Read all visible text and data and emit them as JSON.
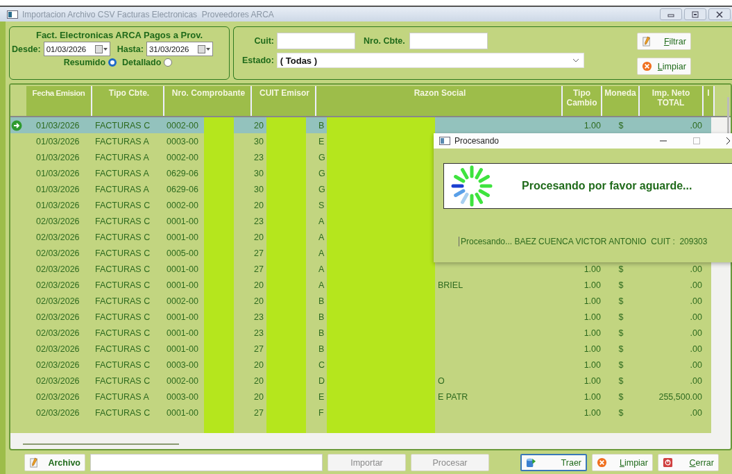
{
  "window": {
    "title": "Importacion Archivo CSV Facturas Electronicas  Proveedores ARCA"
  },
  "period_panel": {
    "title": "Fact. Electronicas ARCA Pagos a Prov.",
    "from_label": "Desde:",
    "from_value": "01/03/2026",
    "to_label": "Hasta:",
    "to_value": "31/03/2026",
    "options": [
      {
        "label": "Resumido",
        "selected": true
      },
      {
        "label": "Detallado",
        "selected": false
      }
    ]
  },
  "filter_panel": {
    "cuit_label": "Cuit:",
    "number_label": "Nro. Cbte.",
    "status_label": "Estado:",
    "status_value": "( Todas )",
    "buttons": [
      {
        "label": "Filtrar",
        "mnemonic": true
      },
      {
        "label": "Limpiar",
        "mnemonic": true
      }
    ]
  },
  "table": {
    "columns": [
      "Fecha Emision",
      "Tipo Cbte.",
      "Nro. Comprobante",
      "CUIT Emisor",
      "Razon Social",
      "Tipo Cambio",
      "Moneda",
      "Imp. Neto TOTAL",
      "I"
    ],
    "rows": [
      {
        "date": "01/03/2026",
        "type": "FACTURAS C",
        "number": "0002-00",
        "cuit": "20",
        "name": "B",
        "rate": "1.00",
        "currency": "$",
        "amount": ".00",
        "selected": true
      },
      {
        "date": "01/03/2026",
        "type": "FACTURAS A",
        "number": "0003-00",
        "cuit": "30",
        "name": "E",
        "selected": false
      },
      {
        "date": "01/03/2026",
        "type": "FACTURAS A",
        "number": "0002-00",
        "cuit": "23",
        "name": "G",
        "selected": false
      },
      {
        "date": "01/03/2026",
        "type": "FACTURAS A",
        "number": "0629-06",
        "cuit": "30",
        "name": "G",
        "selected": false
      },
      {
        "date": "01/03/2026",
        "type": "FACTURAS A",
        "number": "0629-06",
        "cuit": "30",
        "name": "G",
        "selected": false
      },
      {
        "date": "01/03/2026",
        "type": "FACTURAS C",
        "number": "0002-00",
        "cuit": "20",
        "name": "S",
        "selected": false
      },
      {
        "date": "02/03/2026",
        "type": "FACTURAS C",
        "number": "0001-00",
        "cuit": "23",
        "name": "A",
        "selected": false
      },
      {
        "date": "02/03/2026",
        "type": "FACTURAS C",
        "number": "0001-00",
        "cuit": "20",
        "name": "A",
        "selected": false
      },
      {
        "date": "02/03/2026",
        "type": "FACTURAS C",
        "number": "0005-00",
        "cuit": "27",
        "name": "A",
        "selected": false
      },
      {
        "date": "02/03/2026",
        "type": "FACTURAS C",
        "number": "0001-00",
        "cuit": "27",
        "name": "A",
        "rate": "1.00",
        "currency": "$",
        "amount": ".00",
        "selected": false
      },
      {
        "date": "02/03/2026",
        "type": "FACTURAS C",
        "number": "0001-00",
        "cuit": "20",
        "name": "A",
        "name_tail": "BRIEL",
        "rate": "1.00",
        "currency": "$",
        "amount": ".00",
        "selected": false
      },
      {
        "date": "02/03/2026",
        "type": "FACTURAS C",
        "number": "0002-00",
        "cuit": "20",
        "name": "B",
        "rate": "1.00",
        "currency": "$",
        "amount": ".00",
        "selected": false
      },
      {
        "date": "02/03/2026",
        "type": "FACTURAS C",
        "number": "0001-00",
        "cuit": "23",
        "name": "B",
        "rate": "1.00",
        "currency": "$",
        "amount": ".00",
        "selected": false
      },
      {
        "date": "02/03/2026",
        "type": "FACTURAS C",
        "number": "0001-00",
        "cuit": "23",
        "name": "B",
        "rate": "1.00",
        "currency": "$",
        "amount": ".00",
        "selected": false
      },
      {
        "date": "02/03/2026",
        "type": "FACTURAS C",
        "number": "0001-00",
        "cuit": "27",
        "name": "B",
        "rate": "1.00",
        "currency": "$",
        "amount": ".00",
        "selected": false
      },
      {
        "date": "02/03/2026",
        "type": "FACTURAS C",
        "number": "0003-00",
        "cuit": "20",
        "name": "C",
        "rate": "1.00",
        "currency": "$",
        "amount": ".00",
        "selected": false
      },
      {
        "date": "02/03/2026",
        "type": "FACTURAS C",
        "number": "0002-00",
        "cuit": "20",
        "name": "D",
        "name_tail": "O",
        "rate": "1.00",
        "currency": "$",
        "amount": ".00",
        "selected": false
      },
      {
        "date": "02/03/2026",
        "type": "FACTURAS A",
        "number": "0003-00",
        "cuit": "20",
        "name": "E",
        "name_tail": "E PATR",
        "rate": "1.00",
        "currency": "$",
        "amount": "255,500.00",
        "selected": false
      },
      {
        "date": "02/03/2026",
        "type": "FACTURAS C",
        "number": "0001-00",
        "cuit": "27",
        "name": "F",
        "rate": "1.00",
        "currency": "$",
        "amount": ".00",
        "selected": false
      }
    ]
  },
  "bottom_bar": {
    "buttons": [
      {
        "label": "Archivo",
        "disabled": false,
        "focused": false,
        "mnemonic": false
      },
      {
        "kind": "field"
      },
      {
        "label": "Importar",
        "disabled": true,
        "focused": false,
        "mnemonic": false
      },
      {
        "label": "Procesar",
        "disabled": true,
        "focused": false,
        "mnemonic": false
      },
      {
        "label": "Traer",
        "disabled": false,
        "focused": true,
        "mnemonic": false
      },
      {
        "label": "Limpiar",
        "disabled": false,
        "focused": false,
        "mnemonic": true
      },
      {
        "label": "Cerrar",
        "disabled": false,
        "focused": false,
        "mnemonic": true
      }
    ]
  },
  "dialog": {
    "title": "Procesando",
    "message": "Procesando por favor aguarde...",
    "status": "Procesando... BAEZ CUENCA VICTOR ANTONIO  CUIT :  209303"
  }
}
